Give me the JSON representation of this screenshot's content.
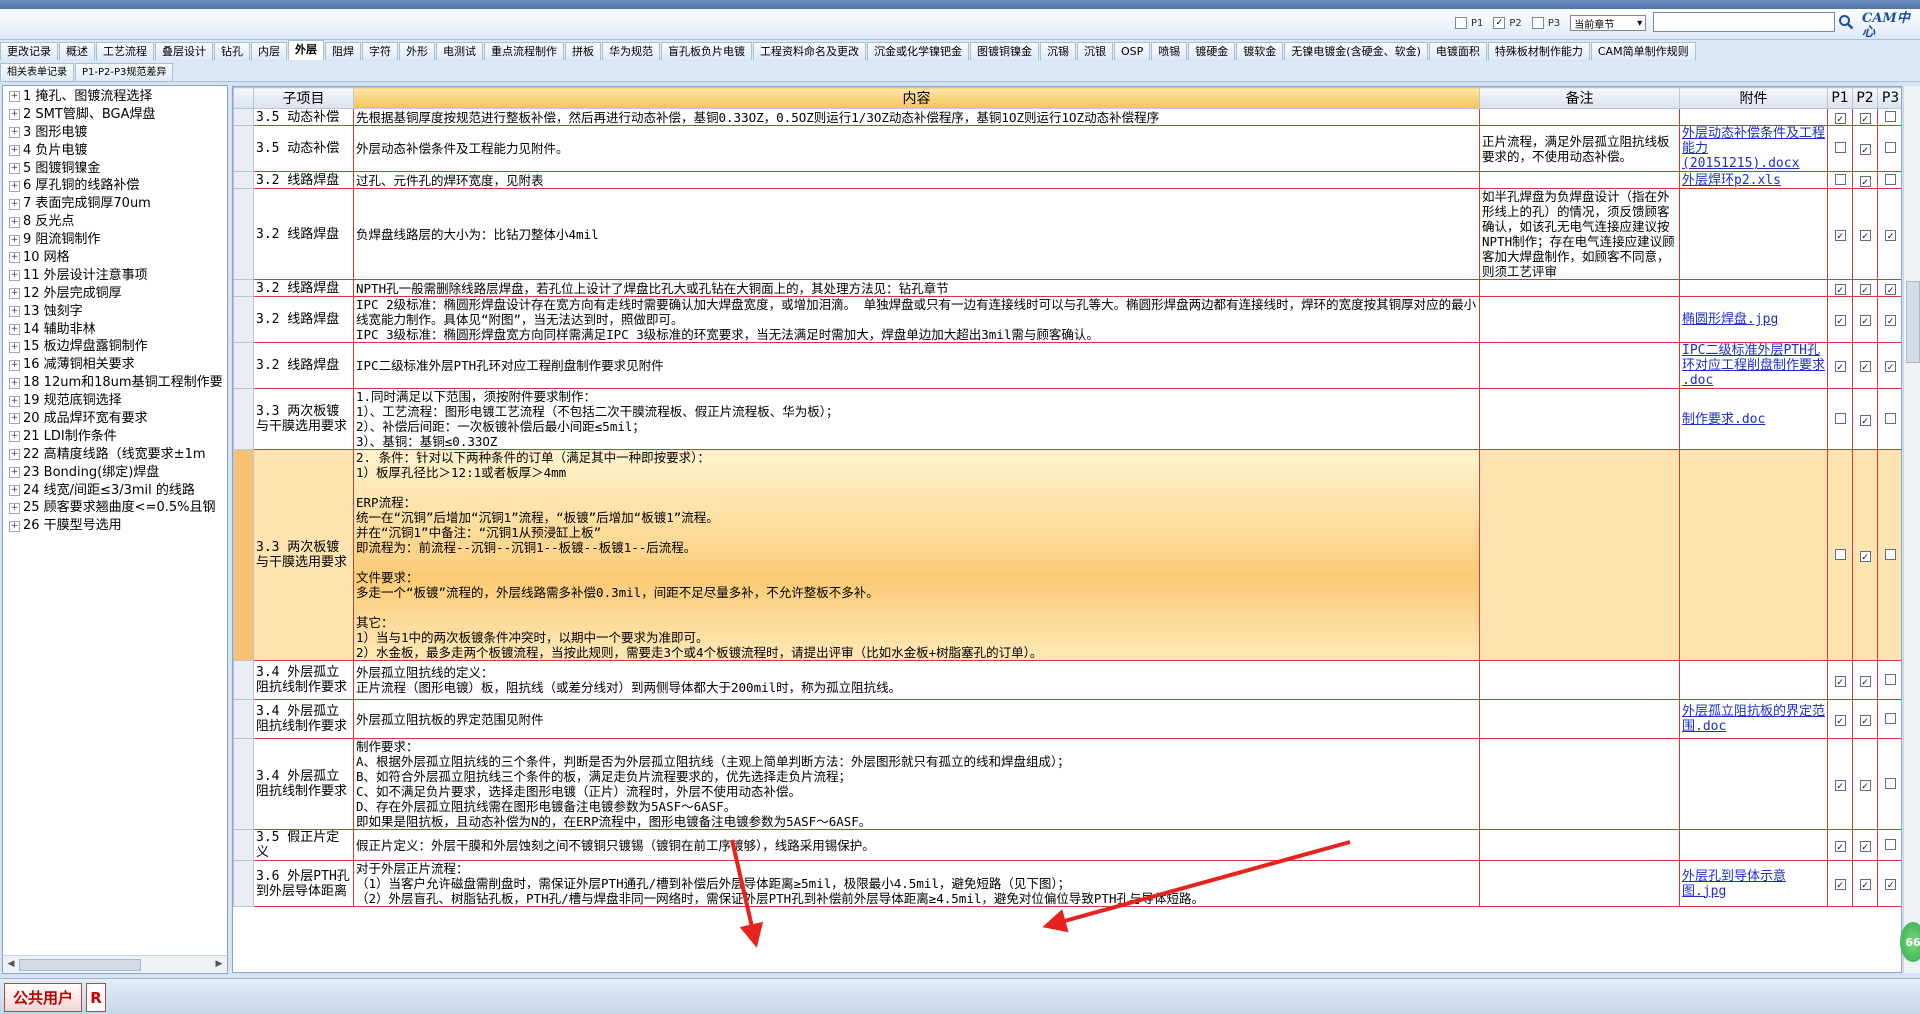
{
  "tabs_row1": [
    "更改记录",
    "概述",
    "工艺流程",
    "叠层设计",
    "钻孔",
    "内层",
    "外层",
    "阻焊",
    "字符",
    "外形",
    "电测试",
    "重点流程制作",
    "拼板",
    "华为规范",
    "盲孔板负片电镀",
    "工程资料命名及更改",
    "沉金或化学镍钯金",
    "图镀铜镍金",
    "沉锡",
    "沉银",
    "OSP",
    "喷锡",
    "镀硬金",
    "镀软金",
    "无镍电镀金(含硬金、软金)",
    "电镀面积",
    "特殊板材制作能力",
    "CAM简单制作规则"
  ],
  "active_tab": "外层",
  "tabs_row2": [
    "相关表单记录",
    "P1-P2-P3规范差异"
  ],
  "options": {
    "p1": "P1",
    "p2": "P2",
    "p3": "P3",
    "p1_checked": false,
    "p2_checked": true,
    "p3_checked": false,
    "chapter_select": "当前章节",
    "chevron": "▾"
  },
  "logo": {
    "text": "CAM中心",
    "sub": "CAM中心"
  },
  "tree": [
    "1 掩孔、图镀流程选择",
    "2 SMT管脚、BGA焊盘",
    "3 图形电镀",
    "4 负片电镀",
    "5 图镀铜镍金",
    "6 厚孔铜的线路补偿",
    "7 表面完成铜厚70um",
    "8 反光点",
    "9 阻流铜制作",
    "10 网格",
    "11 外层设计注意事项",
    "12 外层完成铜厚",
    "13 蚀刻字",
    "14 辅助非林",
    "15 板边焊盘露铜制作",
    "16 减薄铜相关要求",
    "18 12um和18um基铜工程制作要",
    "19 规范底铜选择",
    "20 成品焊环宽有要求",
    "21 LDI制作条件",
    "22 高精度线路（线宽要求±1m",
    "23 Bonding(绑定)焊盘",
    "24 线宽/间距≤3/3mil 的线路",
    "25 顾客要求翘曲度<=0.5%且钢",
    "26 干膜型号选用"
  ],
  "headers": {
    "sub": "子项目",
    "content": "内容",
    "note": "备注",
    "attach": "附件",
    "p1": "P1",
    "p2": "P2",
    "p3": "P3"
  },
  "rows": [
    {
      "sub": "3.5 动态补偿",
      "content": "先根据基铜厚度按规范进行整板补偿，然后再进行动态补偿，基铜0.33OZ，0.5OZ则运行1/3OZ动态补偿程序，基铜1OZ则运行1OZ动态补偿程序",
      "note": "",
      "attach": "",
      "p1": true,
      "p2": true,
      "p3": false
    },
    {
      "sub": "3.5 动态补偿",
      "content": "外层动态补偿条件及工程能力见附件。",
      "note": "正片流程，满足外层孤立阻抗线板要求的，不使用动态补偿。",
      "attach": "外层动态补偿条件及工程能力(20151215).docx",
      "p1": false,
      "p2": true,
      "p3": false
    },
    {
      "sub": "3.2 线路焊盘",
      "content": "过孔、元件孔的焊环宽度，见附表",
      "note": "",
      "attach": "外层焊环p2.xls",
      "p1": false,
      "p2": true,
      "p3": false
    },
    {
      "sub": "3.2 线路焊盘",
      "content": "负焊盘线路层的大小为：比钻刀整体小4mil",
      "note": "如半孔焊盘为负焊盘设计（指在外形线上的孔）的情况，须反馈顾客确认，如该孔无电气连接应建议按NPTH制作；存在电气连接应建议顾客加大焊盘制作，如顾客不同意，则须工艺评审",
      "attach": "",
      "p1": true,
      "p2": true,
      "p3": true
    },
    {
      "sub": "3.2 线路焊盘",
      "content": "NPTH孔一般需删除线路层焊盘，若孔位上设计了焊盘比孔大或孔钻在大铜面上的，其处理方法见：钻孔章节",
      "note": "",
      "attach": "",
      "p1": true,
      "p2": true,
      "p3": true
    },
    {
      "sub": "3.2 线路焊盘",
      "content": "IPC 2级标准：椭圆形焊盘设计存在宽方向有走线时需要确认加大焊盘宽度，或增加泪滴。 单独焊盘或只有一边有连接线时可以与孔等大。椭圆形焊盘两边都有连接线时，焊环的宽度按其铜厚对应的最小线宽能力制作。具体见“附图”，当无法达到时，照做即可。\nIPC 3级标准：椭圆形焊盘宽方向同样需满足IPC 3级标准的环宽要求，当无法满足时需加大，焊盘单边加大超出3mil需与顾客确认。",
      "note": "",
      "attach": "椭圆形焊盘.jpg",
      "p1": true,
      "p2": true,
      "p3": true
    },
    {
      "sub": "3.2 线路焊盘",
      "content": "IPC二级标准外层PTH孔环对应工程削盘制作要求见附件",
      "note": "",
      "attach": "IPC二级标准外层PTH孔环对应工程削盘制作要求 .doc",
      "p1": true,
      "p2": true,
      "p3": true
    },
    {
      "sub": "3.3 两次板镀与干膜选用要求",
      "content": "1.同时满足以下范围，须按附件要求制作：\n1）、工艺流程：图形电镀工艺流程（不包括二次干膜流程板、假正片流程板、华为板）；\n2）、补偿后间距：一次板镀补偿后最小间距≤5mil；\n3）、基铜：基铜≤0.33OZ",
      "note": "",
      "attach": "制作要求.doc",
      "p1": false,
      "p2": true,
      "p3": false
    },
    {
      "sub": "3.3 两次板镀与干膜选用要求",
      "content": "2. 条件：针对以下两种条件的订单（满足其中一种即按要求）：\n1）板厚孔径比＞12:1或者板厚＞4mm\n\nERP流程：\n统一在“沉铜”后增加“沉铜1”流程，“板镀”后增加“板镀1”流程。\n并在“沉铜1”中备注：“沉铜1从预浸缸上板”\n即流程为：前流程--沉铜--沉铜1--板镀--板镀1--后流程。\n\n文件要求：\n多走一个“板镀”流程的，外层线路需多补偿0.3mil，间距不足尽量多补，不允许整板不多补。\n\n其它：\n1）当与1中的两次板镀条件冲突时，以期中一个要求为准即可。\n2）水金板，最多走两个板镀流程，当按此规则，需要走3个或4个板镀流程时，请提出评审（比如水金板+树脂塞孔的订单）。",
      "note": "",
      "attach": "",
      "p1": false,
      "p2": true,
      "p3": false
    },
    {
      "sub": "3.4 外层孤立阻抗线制作要求",
      "content": "外层孤立阻抗线的定义：\n正片流程（图形电镀）板，阻抗线（或差分线对）到两侧导体都大于200mil时，称为孤立阻抗线。",
      "note": "",
      "attach": "",
      "p1": true,
      "p2": true,
      "p3": false
    },
    {
      "sub": "3.4 外层孤立阻抗线制作要求",
      "content": "外层孤立阻抗板的界定范围见附件",
      "note": "",
      "attach": "外层孤立阻抗板的界定范围.doc",
      "p1": true,
      "p2": true,
      "p3": false
    },
    {
      "sub": "3.4 外层孤立阻抗线制作要求",
      "content": "制作要求：\nA、根据外层孤立阻抗线的三个条件，判断是否为外层孤立阻抗线（主观上简单判断方法：外层图形就只有孤立的线和焊盘组成）；\nB、如符合外层孤立阻抗线三个条件的板，满足走负片流程要求的，优先选择走负片流程；\nC、如不满足负片要求，选择走图形电镀（正片）流程时，外层不使用动态补偿。\nD、存在外层孤立阻抗线需在图形电镀备注电镀参数为5ASF～6ASF。\n即如果是阻抗板，且动态补偿为N的，在ERP流程中，图形电镀备注电镀参数为5ASF～6ASF。",
      "note": "",
      "attach": "",
      "p1": true,
      "p2": true,
      "p3": false
    },
    {
      "sub": "3.5 假正片定义",
      "content": "假正片定义：外层干膜和外层蚀刻之间不镀铜只镀锡（镀铜在前工序镀够），线路采用锡保护。",
      "note": "",
      "attach": "",
      "p1": true,
      "p2": true,
      "p3": false
    },
    {
      "sub": "3.6 外层PTH孔到外层导体距离",
      "content": "对于外层正片流程：\n（1）当客户允许磁盘需削盘时，需保证外层PTH通孔/槽到补偿后外层导体距离≥5mil，极限最小4.5mil，避免短路（见下图）；\n（2）外层盲孔、树脂钻孔板，PTH孔/槽与焊盘非同一网络时，需保证外层PTH孔到补偿前外层导体距离≥4.5mil，避免对位偏位导致PTH孔与导体短路。",
      "note": "",
      "attach": "外层孔到导体示意图.jpg",
      "p1": true,
      "p2": true,
      "p3": true
    }
  ],
  "badge": "66",
  "status": {
    "user": "公共用户",
    "r": "R"
  },
  "colors": {
    "border_red": "#d23a3a",
    "selected": "#fbca74",
    "link": "#1c30c8",
    "arrow": "#e8231d"
  }
}
